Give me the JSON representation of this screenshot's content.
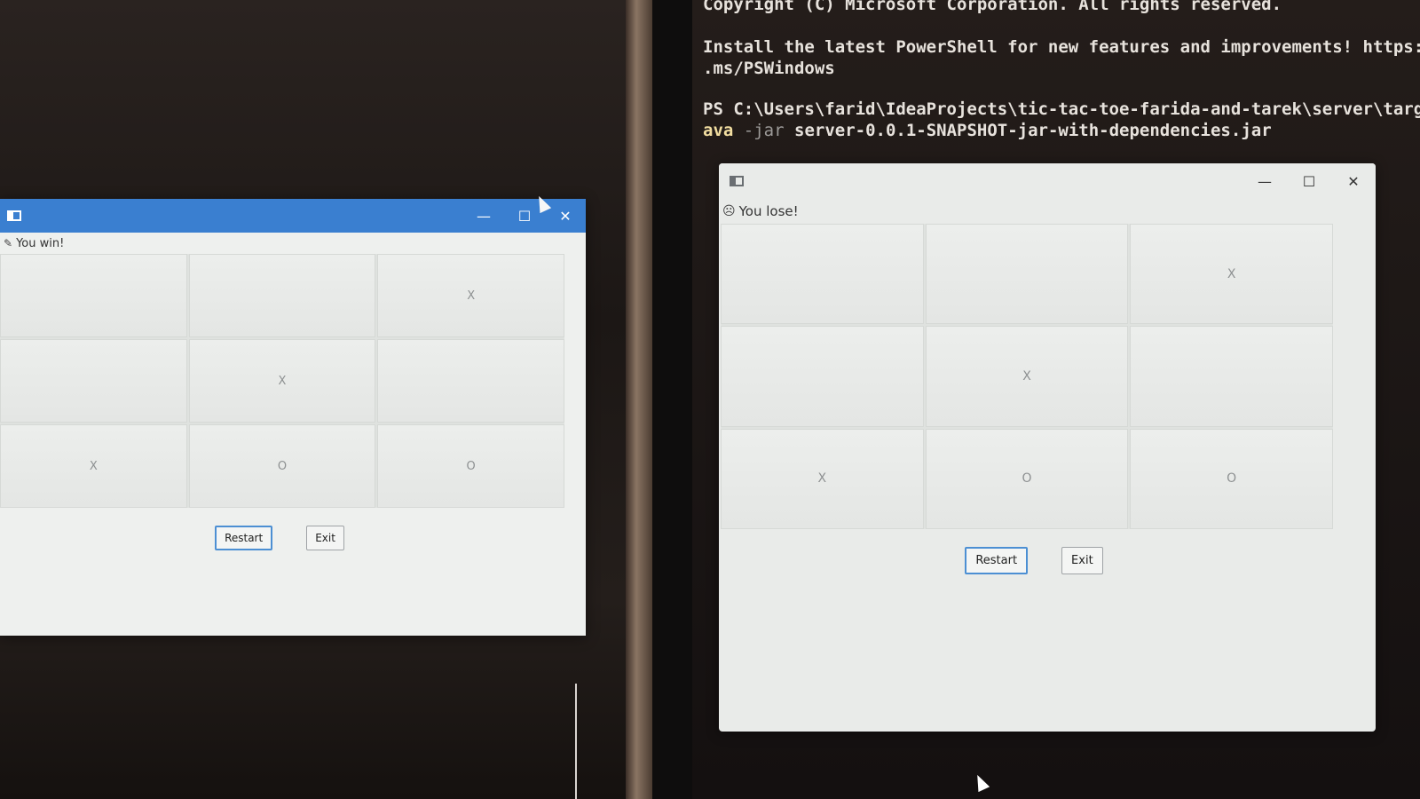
{
  "terminal": {
    "line1": "Copyright (C) Microsoft Corporation. All rights reserved.",
    "line2a": "Install the latest PowerShell for new features and improvements! https://",
    "line2b": ".ms/PSWindows",
    "prompt": "PS C:\\Users\\farid\\IdeaProjects\\tic-tac-toe-farida-and-tarek\\server\\target",
    "cmd_kw": "ava",
    "cmd_flag": "-jar",
    "cmd_file": "server-0.0.1-SNAPSHOT-jar-with-dependencies.jar"
  },
  "left_window": {
    "status": "You win!",
    "board": [
      "",
      "",
      "X",
      "",
      "X",
      "",
      "X",
      "O",
      "O"
    ],
    "restart": "Restart",
    "exit": "Exit"
  },
  "right_window": {
    "status": "You lose!",
    "board": [
      "",
      "",
      "X",
      "",
      "X",
      "",
      "X",
      "O",
      "O"
    ],
    "restart": "Restart",
    "exit": "Exit"
  },
  "window_controls": {
    "minimize": "—",
    "maximize": "☐",
    "close": "✕"
  },
  "colors": {
    "titlebar_active": "#3a7fd0",
    "accent_border": "#4c8fd3"
  }
}
